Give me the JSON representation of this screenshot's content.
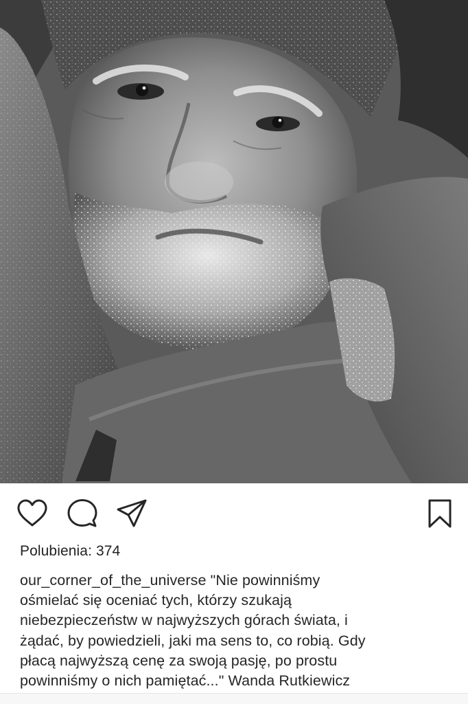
{
  "post": {
    "photo_alt": "black and white portrait",
    "likes_text": "Polubienia: 374",
    "caption": {
      "username": "our_corner_of_the_universe",
      "first_line_rest": " \"Nie powinniśmy",
      "lines": [
        "ośmielać się oceniać tych, którzy szukają",
        "niebezpieczeństw w najwyższych górach świata, i",
        "żądać, by powiedzieli, jaki ma sens to, co robią. Gdy",
        "płacą najwyższą cenę za swoją pasję, po prostu",
        "powinniśmy o nich pamiętać...\" Wanda Rutkiewicz"
      ]
    },
    "actions": {
      "like_icon": "heart-icon",
      "comment_icon": "comment-bubble-icon",
      "share_icon": "paper-plane-icon",
      "save_icon": "bookmark-icon"
    }
  }
}
